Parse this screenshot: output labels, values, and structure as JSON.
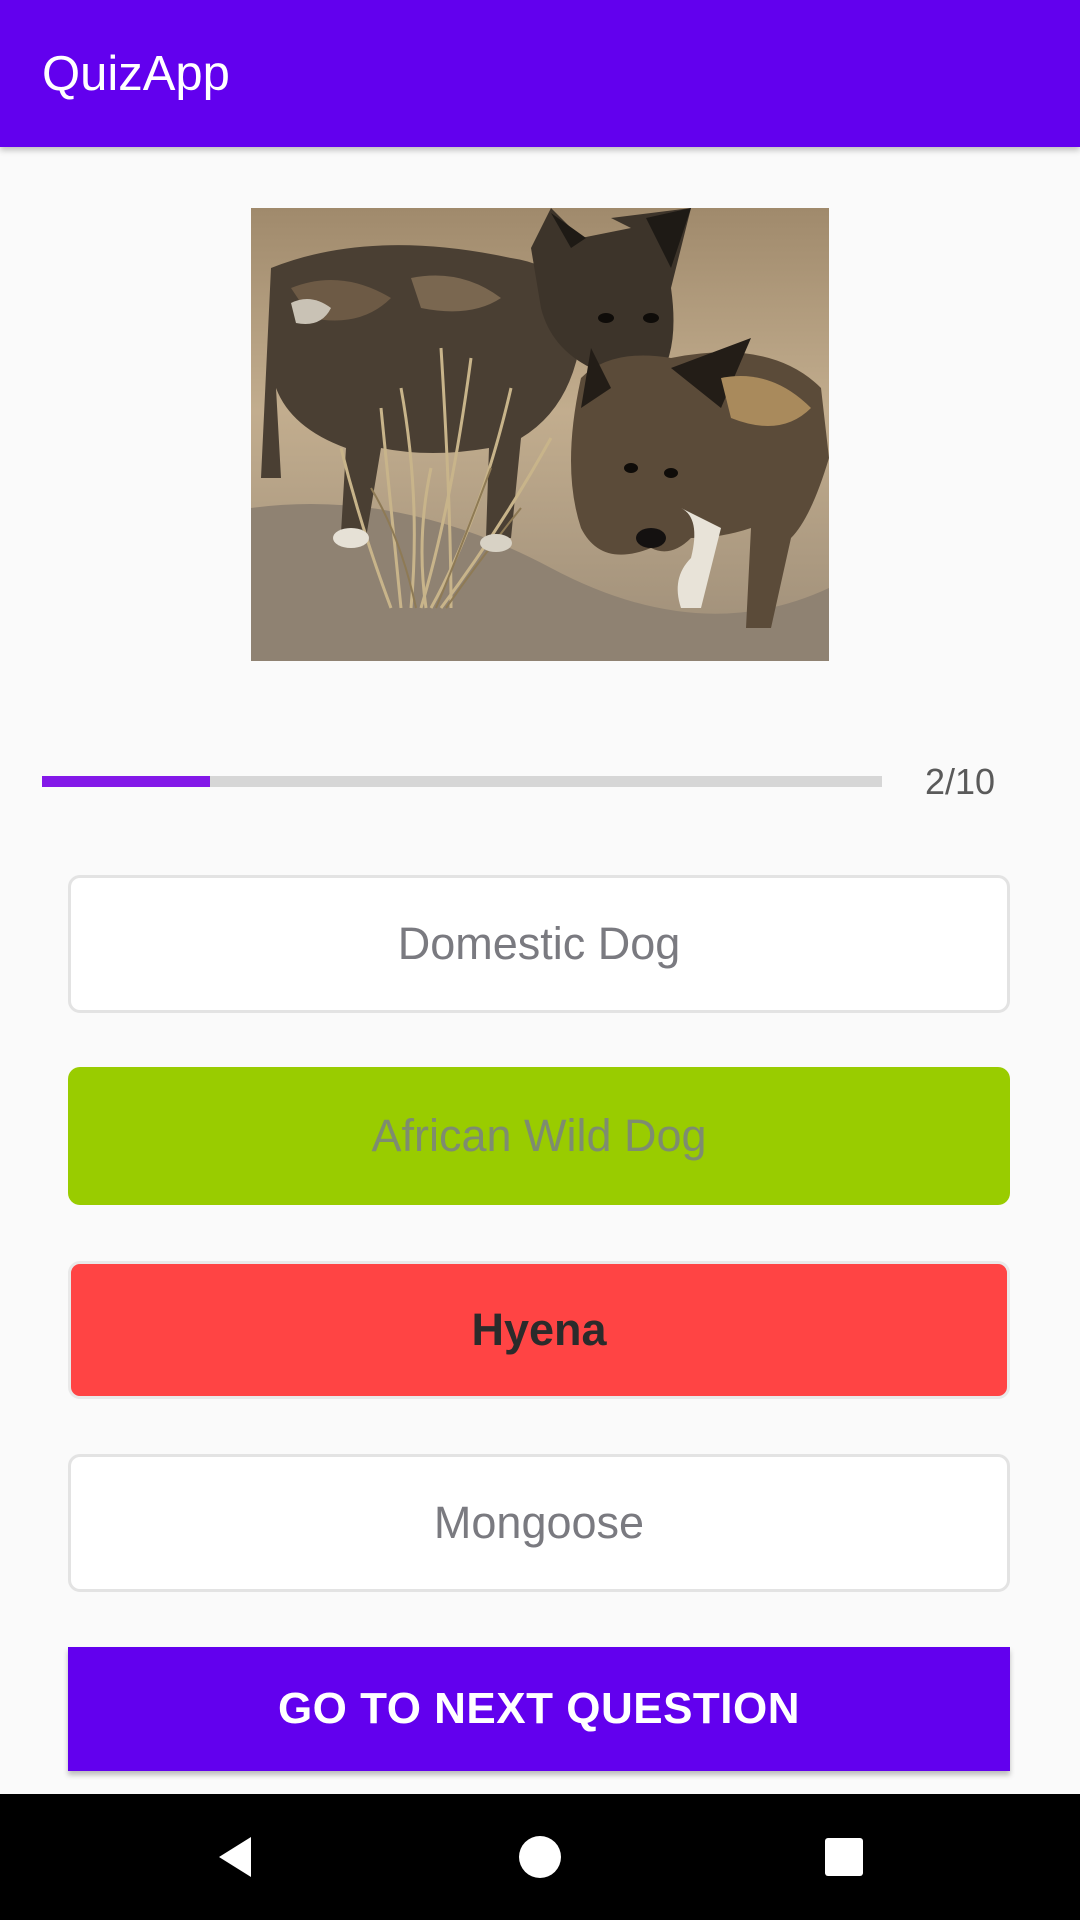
{
  "app_bar": {
    "title": "QuizApp",
    "color": "#6200ee"
  },
  "question": {
    "image_alt": "African wild dog pups"
  },
  "progress": {
    "current": 2,
    "total": 10,
    "fraction": 0.2,
    "label": "2/10",
    "fill_color": "#8318e8"
  },
  "options": [
    {
      "label": "Domestic Dog",
      "state": "default"
    },
    {
      "label": "African Wild Dog",
      "state": "correct",
      "color": "#99cc00"
    },
    {
      "label": "Hyena",
      "state": "wrong",
      "color": "#ff4444"
    },
    {
      "label": "Mongoose",
      "state": "default"
    }
  ],
  "actions": {
    "next_label": "GO TO NEXT QUESTION"
  },
  "nav_bar": {
    "icons": [
      "back-icon",
      "home-icon",
      "recents-icon"
    ]
  }
}
